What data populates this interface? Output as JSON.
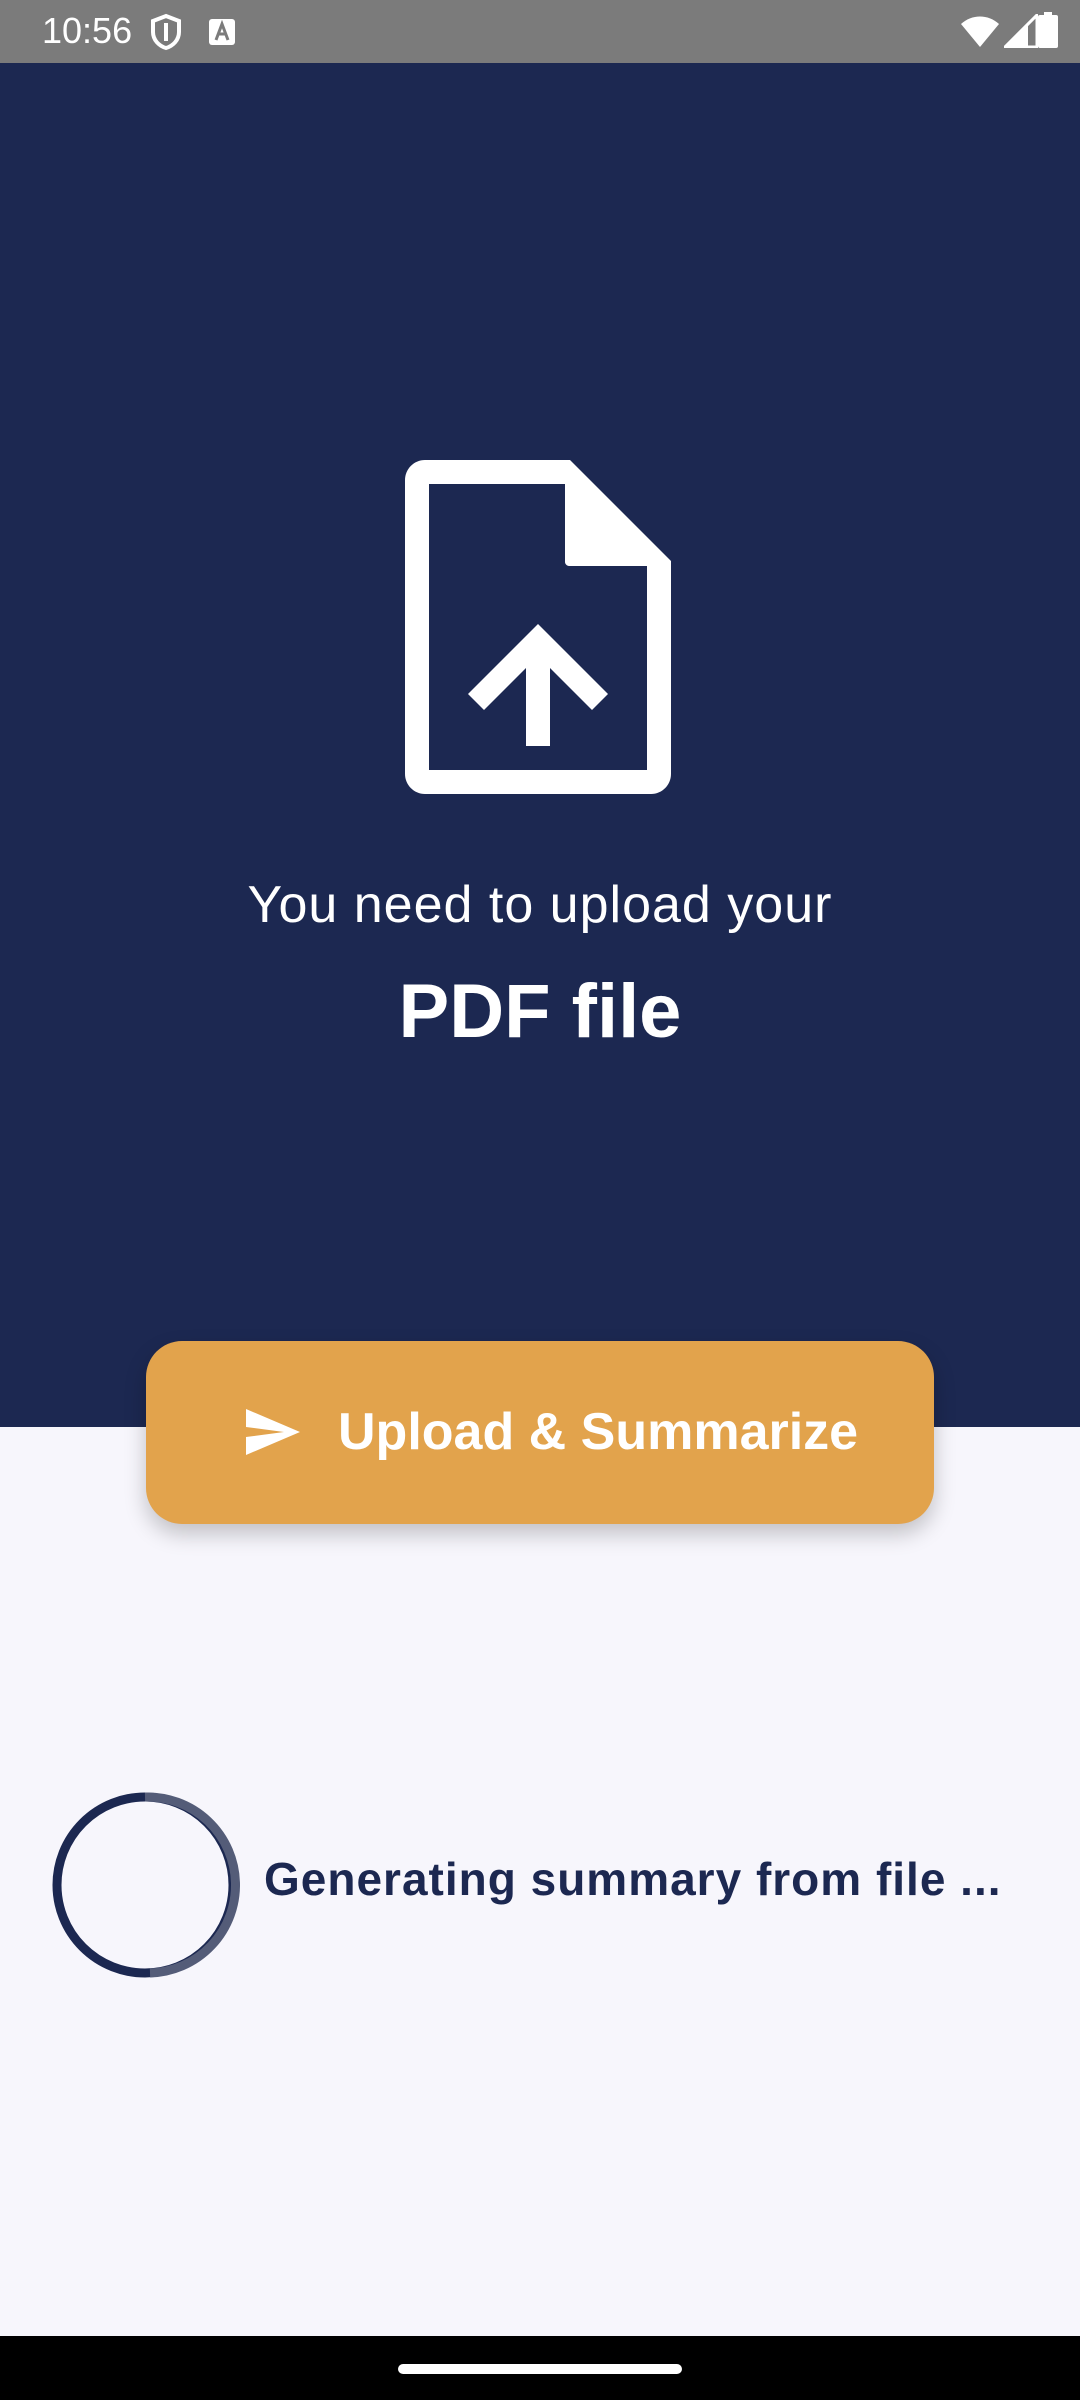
{
  "status_bar": {
    "time": "10:56",
    "icons": [
      "shield-icon",
      "a-icon",
      "wifi-icon",
      "signal-icon",
      "battery-icon"
    ]
  },
  "hero": {
    "icon": "file-upload-icon",
    "line1": "You need to upload your",
    "line2": "PDF file",
    "background_color": "#1c2851"
  },
  "upload_button": {
    "label": "Upload & Summarize",
    "icon": "send-icon",
    "color": "#e2a34c"
  },
  "progress": {
    "text": "Generating summary from file ...",
    "icon": "spinner-icon"
  },
  "colors": {
    "navy": "#1c2851",
    "accent": "#e2a34c",
    "background": "#f7f6fc"
  }
}
